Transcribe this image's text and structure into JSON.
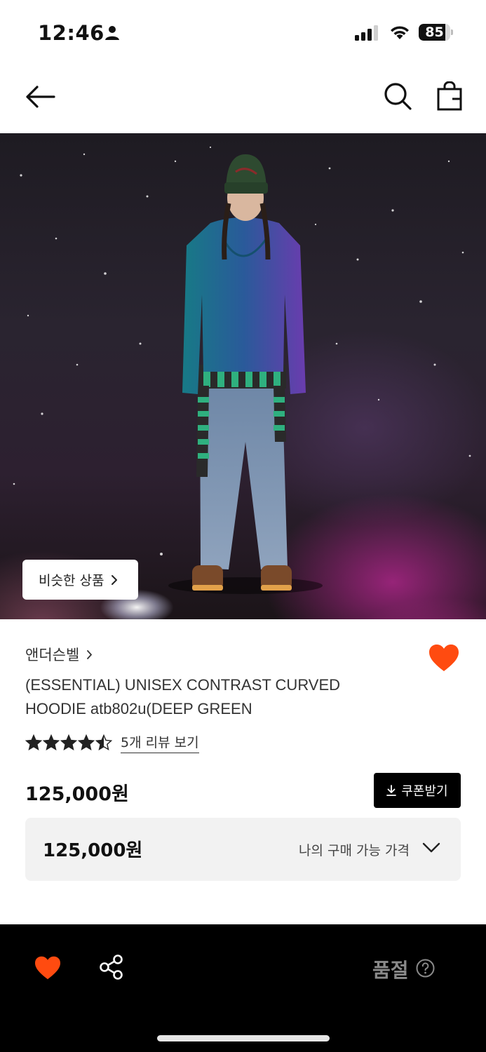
{
  "status_bar": {
    "time": "12:46",
    "battery": "85",
    "battery_fraction": 0.85
  },
  "nav": {
    "back_icon": "arrow-left-icon",
    "search_icon": "search-icon",
    "bag_icon": "shopping-bag-icon"
  },
  "hero": {
    "similar_label": "비슷한 상품"
  },
  "product": {
    "brand": "앤더슨벨",
    "title": "(ESSENTIAL) UNISEX CONTRAST CURVED HOODIE atb802u(DEEP GREEN",
    "rating": 4.5,
    "review_link": "5개 리뷰 보기",
    "price": "125,000원",
    "coupon_label": "쿠폰받기",
    "my_price": "125,000원",
    "my_price_label": "나의 구매 가능 가격"
  },
  "bottom_bar": {
    "status_label": "품절"
  },
  "colors": {
    "accent": "#ff4b10",
    "soldout": "#8a8a8a",
    "price_box_bg": "#f2f2f2"
  }
}
